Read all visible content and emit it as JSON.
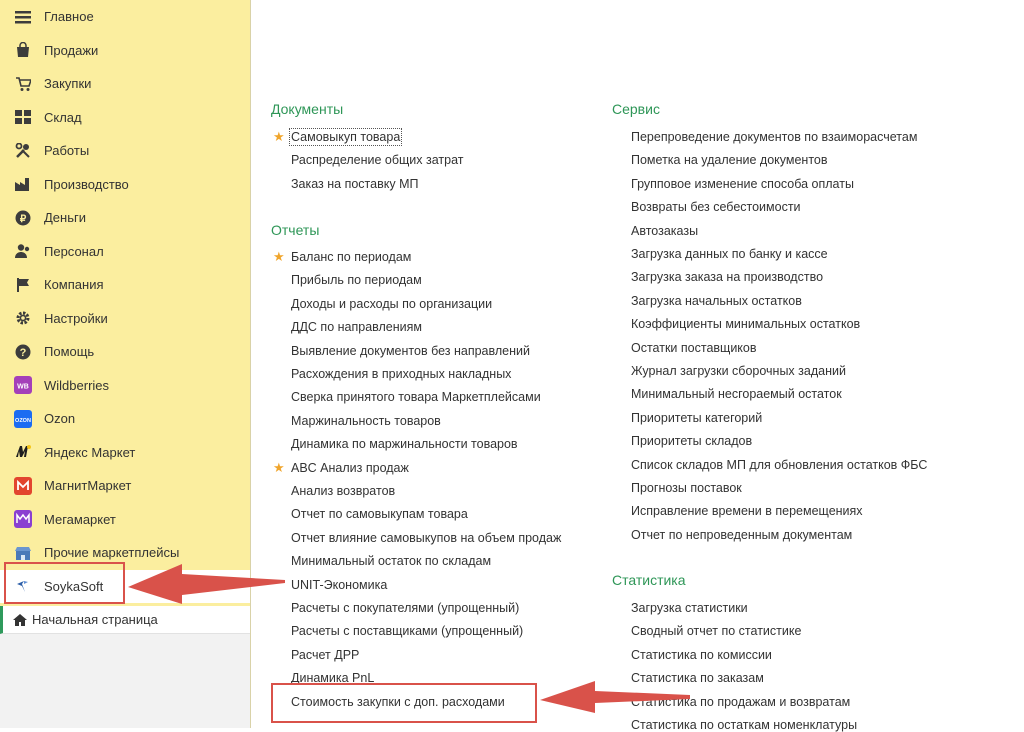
{
  "sidebar": {
    "items": [
      {
        "label": "Главное",
        "icon": "hamburger-icon"
      },
      {
        "label": "Продажи",
        "icon": "shopping-bag-icon"
      },
      {
        "label": "Закупки",
        "icon": "cart-icon"
      },
      {
        "label": "Склад",
        "icon": "grid-icon"
      },
      {
        "label": "Работы",
        "icon": "tools-icon"
      },
      {
        "label": "Производство",
        "icon": "factory-icon"
      },
      {
        "label": "Деньги",
        "icon": "money-icon"
      },
      {
        "label": "Персонал",
        "icon": "people-icon"
      },
      {
        "label": "Компания",
        "icon": "flag-icon"
      },
      {
        "label": "Настройки",
        "icon": "gear-icon"
      },
      {
        "label": "Помощь",
        "icon": "help-icon"
      },
      {
        "label": "Wildberries",
        "icon": "wildberries-icon"
      },
      {
        "label": "Ozon",
        "icon": "ozon-icon"
      },
      {
        "label": "Яндекс Маркет",
        "icon": "yandex-market-icon"
      },
      {
        "label": "МагнитМаркет",
        "icon": "magnit-market-icon"
      },
      {
        "label": "Мегамаркет",
        "icon": "megamarket-icon"
      },
      {
        "label": "Прочие маркетплейсы",
        "icon": "marketplaces-icon"
      },
      {
        "label": "SoykaSoft",
        "icon": "soykasoft-icon"
      }
    ],
    "home": {
      "label": "Начальная страница",
      "icon": "home-icon"
    }
  },
  "main": {
    "documents": {
      "title": "Документы",
      "items": [
        {
          "label": "Самовыкуп товара",
          "starred": true
        },
        {
          "label": "Распределение общих затрат",
          "starred": false
        },
        {
          "label": "Заказ на поставку МП",
          "starred": false
        }
      ]
    },
    "reports": {
      "title": "Отчеты",
      "items": [
        {
          "label": "Баланс по периодам",
          "starred": true
        },
        {
          "label": "Прибыль по периодам",
          "starred": false
        },
        {
          "label": "Доходы и расходы по организации",
          "starred": false
        },
        {
          "label": "ДДС по направлениям",
          "starred": false
        },
        {
          "label": "Выявление документов без направлений",
          "starred": false
        },
        {
          "label": "Расхождения в приходных накладных",
          "starred": false
        },
        {
          "label": "Сверка принятого товара Маркетплейсами",
          "starred": false
        },
        {
          "label": "Маржинальность товаров",
          "starred": false
        },
        {
          "label": "Динамика по маржинальности товаров",
          "starred": false
        },
        {
          "label": "ABC Анализ продаж",
          "starred": true
        },
        {
          "label": "Анализ возвратов",
          "starred": false
        },
        {
          "label": "Отчет по самовыкупам товара",
          "starred": false
        },
        {
          "label": "Отчет влияние самовыкупов на объем продаж",
          "starred": false
        },
        {
          "label": "Минимальный остаток по складам",
          "starred": false
        },
        {
          "label": "UNIT-Экономика",
          "starred": false
        },
        {
          "label": "Расчеты с покупателями (упрощенный)",
          "starred": false
        },
        {
          "label": "Расчеты с поставщиками (упрощенный)",
          "starred": false
        },
        {
          "label": "Расчет ДРР",
          "starred": false
        },
        {
          "label": "Динамика PnL",
          "starred": false
        },
        {
          "label": "Стоимость закупки с доп. расходами",
          "starred": false
        }
      ]
    },
    "service": {
      "title": "Сервис",
      "items": [
        {
          "label": "Перепроведение документов по взаиморасчетам"
        },
        {
          "label": "Пометка на удаление документов"
        },
        {
          "label": "Групповое изменение способа оплаты"
        },
        {
          "label": "Возвраты без себестоимости"
        },
        {
          "label": "Автозаказы"
        },
        {
          "label": "Загрузка данных по банку и кассе"
        },
        {
          "label": "Загрузка заказа на производство"
        },
        {
          "label": "Загрузка начальных остатков"
        },
        {
          "label": "Коэффициенты минимальных остатков"
        },
        {
          "label": "Остатки поставщиков"
        },
        {
          "label": "Журнал загрузки сборочных заданий"
        },
        {
          "label": "Минимальный несгораемый остаток"
        },
        {
          "label": "Приоритеты категорий"
        },
        {
          "label": "Приоритеты складов"
        },
        {
          "label": "Список складов МП для обновления остатков ФБС"
        },
        {
          "label": "Прогнозы поставок"
        },
        {
          "label": "Исправление времени в перемещениях"
        },
        {
          "label": "Отчет по непроведенным документам"
        }
      ]
    },
    "statistics": {
      "title": "Статистика",
      "items": [
        {
          "label": "Загрузка статистики"
        },
        {
          "label": "Сводный отчет по статистике"
        },
        {
          "label": "Статистика по комиссии"
        },
        {
          "label": "Статистика по заказам"
        },
        {
          "label": "Статистика по продажам и возвратам"
        },
        {
          "label": "Статистика по остаткам номенклатуры"
        }
      ]
    }
  },
  "colors": {
    "sidebar_bg": "#fbee9f",
    "section_title": "#2e9657",
    "star": "#f0a52c",
    "annotation_red": "#d9524a"
  }
}
